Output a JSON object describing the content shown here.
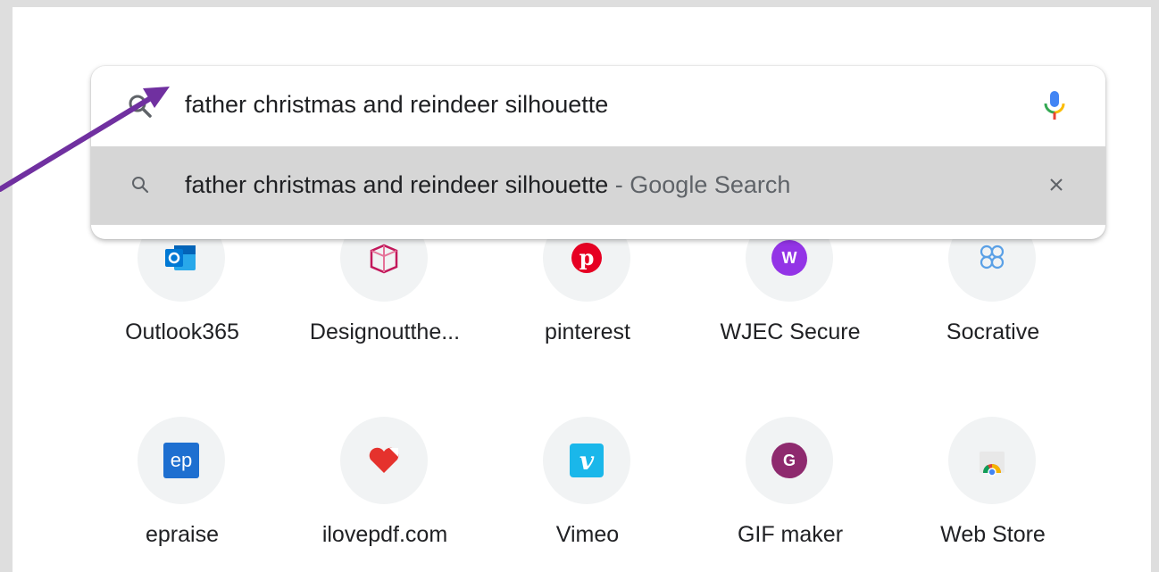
{
  "omnibox": {
    "query": "father christmas and reindeer silhouette",
    "suggestion": {
      "text": "father christmas and reindeer silhouette",
      "separator": " - ",
      "source": "Google Search"
    }
  },
  "shortcuts": [
    {
      "label": "Outlook365",
      "icon": "outlook-icon"
    },
    {
      "label": "Designoutthe...",
      "icon": "designout-icon"
    },
    {
      "label": "pinterest",
      "icon": "pinterest-icon"
    },
    {
      "label": "WJEC Secure",
      "icon": "wjec-icon"
    },
    {
      "label": "Socrative",
      "icon": "socrative-icon"
    },
    {
      "label": "epraise",
      "icon": "epraise-icon"
    },
    {
      "label": "ilovepdf.com",
      "icon": "ilovepdf-icon"
    },
    {
      "label": "Vimeo",
      "icon": "vimeo-icon"
    },
    {
      "label": "GIF maker",
      "icon": "gif-maker-icon"
    },
    {
      "label": "Web Store",
      "icon": "web-store-icon"
    }
  ],
  "icon_letters": {
    "wjec": "W",
    "epraise": "ep",
    "vimeo": "v",
    "gif": "G"
  },
  "colors": {
    "annotation_arrow": "#7030a0",
    "pinterest": "#e60023",
    "wjec": "#9334e6",
    "gif": "#8e2a6e",
    "vimeo": "#1ab7ea",
    "epraise": "#1e6fd0"
  }
}
